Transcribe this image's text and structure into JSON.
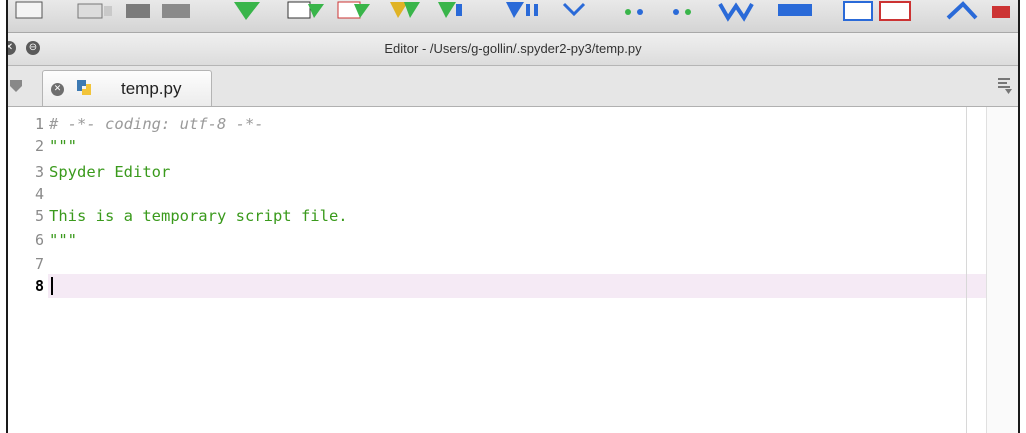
{
  "window": {
    "title": "Editor - /Users/g-gollin/.spyder2-py3/temp.py"
  },
  "toolbar": {
    "icons": [
      "new-file-icon",
      "open-file-icon",
      "save-icon",
      "run-icon",
      "run-cell-icon",
      "debug-icon",
      "step-icon",
      "profile-icon",
      "plot-icon",
      "maximize-icon",
      "layout-icon"
    ]
  },
  "tab": {
    "label": "temp.py"
  },
  "editor": {
    "lines": [
      {
        "num": "1",
        "text": "# -*- coding: utf-8 -*-",
        "kind": "comment"
      },
      {
        "num": "2",
        "text": "\"\"\"",
        "kind": "string"
      },
      {
        "num": "3",
        "text": "Spyder Editor",
        "kind": "string"
      },
      {
        "num": "4",
        "text": "",
        "kind": "string"
      },
      {
        "num": "5",
        "text": "This is a temporary script file.",
        "kind": "string"
      },
      {
        "num": "6",
        "text": "\"\"\"",
        "kind": "string"
      },
      {
        "num": "7",
        "text": "",
        "kind": "plain"
      },
      {
        "num": "8",
        "text": "",
        "kind": "plain"
      }
    ],
    "current_line": "8"
  },
  "colors": {
    "string": "#3a9a1c",
    "comment": "#9a9a9a",
    "current_line_bg": "#f5eaf5"
  }
}
